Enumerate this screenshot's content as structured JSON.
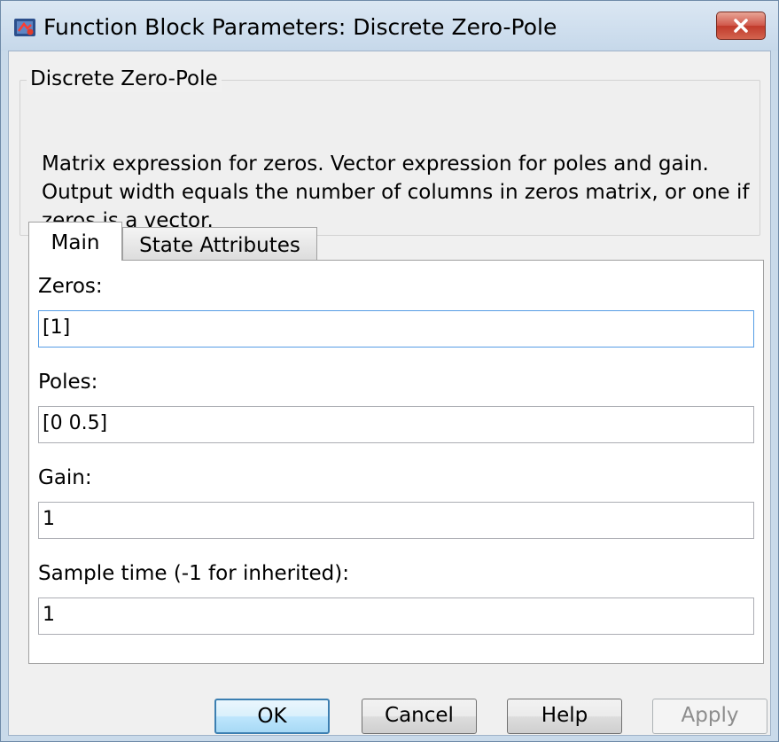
{
  "window": {
    "title": "Function Block Parameters: Discrete Zero-Pole",
    "icon": "simulink-block-icon",
    "close_icon": "close-icon"
  },
  "group": {
    "legend": "Discrete Zero-Pole",
    "description": "Matrix expression for zeros.  Vector expression for poles and gain. Output width equals the number of columns in zeros matrix, or one if zeros is a vector."
  },
  "tabs": [
    {
      "label": "Main",
      "selected": true
    },
    {
      "label": "State Attributes",
      "selected": false
    }
  ],
  "fields": {
    "zeros": {
      "label": "Zeros:",
      "value": "[1]"
    },
    "poles": {
      "label": "Poles:",
      "value": "[0 0.5]"
    },
    "gain": {
      "label": "Gain:",
      "value": "1"
    },
    "sample_time": {
      "label": "Sample time (-1 for inherited):",
      "value": "1"
    }
  },
  "buttons": {
    "ok": "OK",
    "cancel": "Cancel",
    "help": "Help",
    "apply": "Apply"
  },
  "colors": {
    "titlebar": "#c9daea",
    "close_button": "#c9402f",
    "focus_border": "#569de5"
  }
}
